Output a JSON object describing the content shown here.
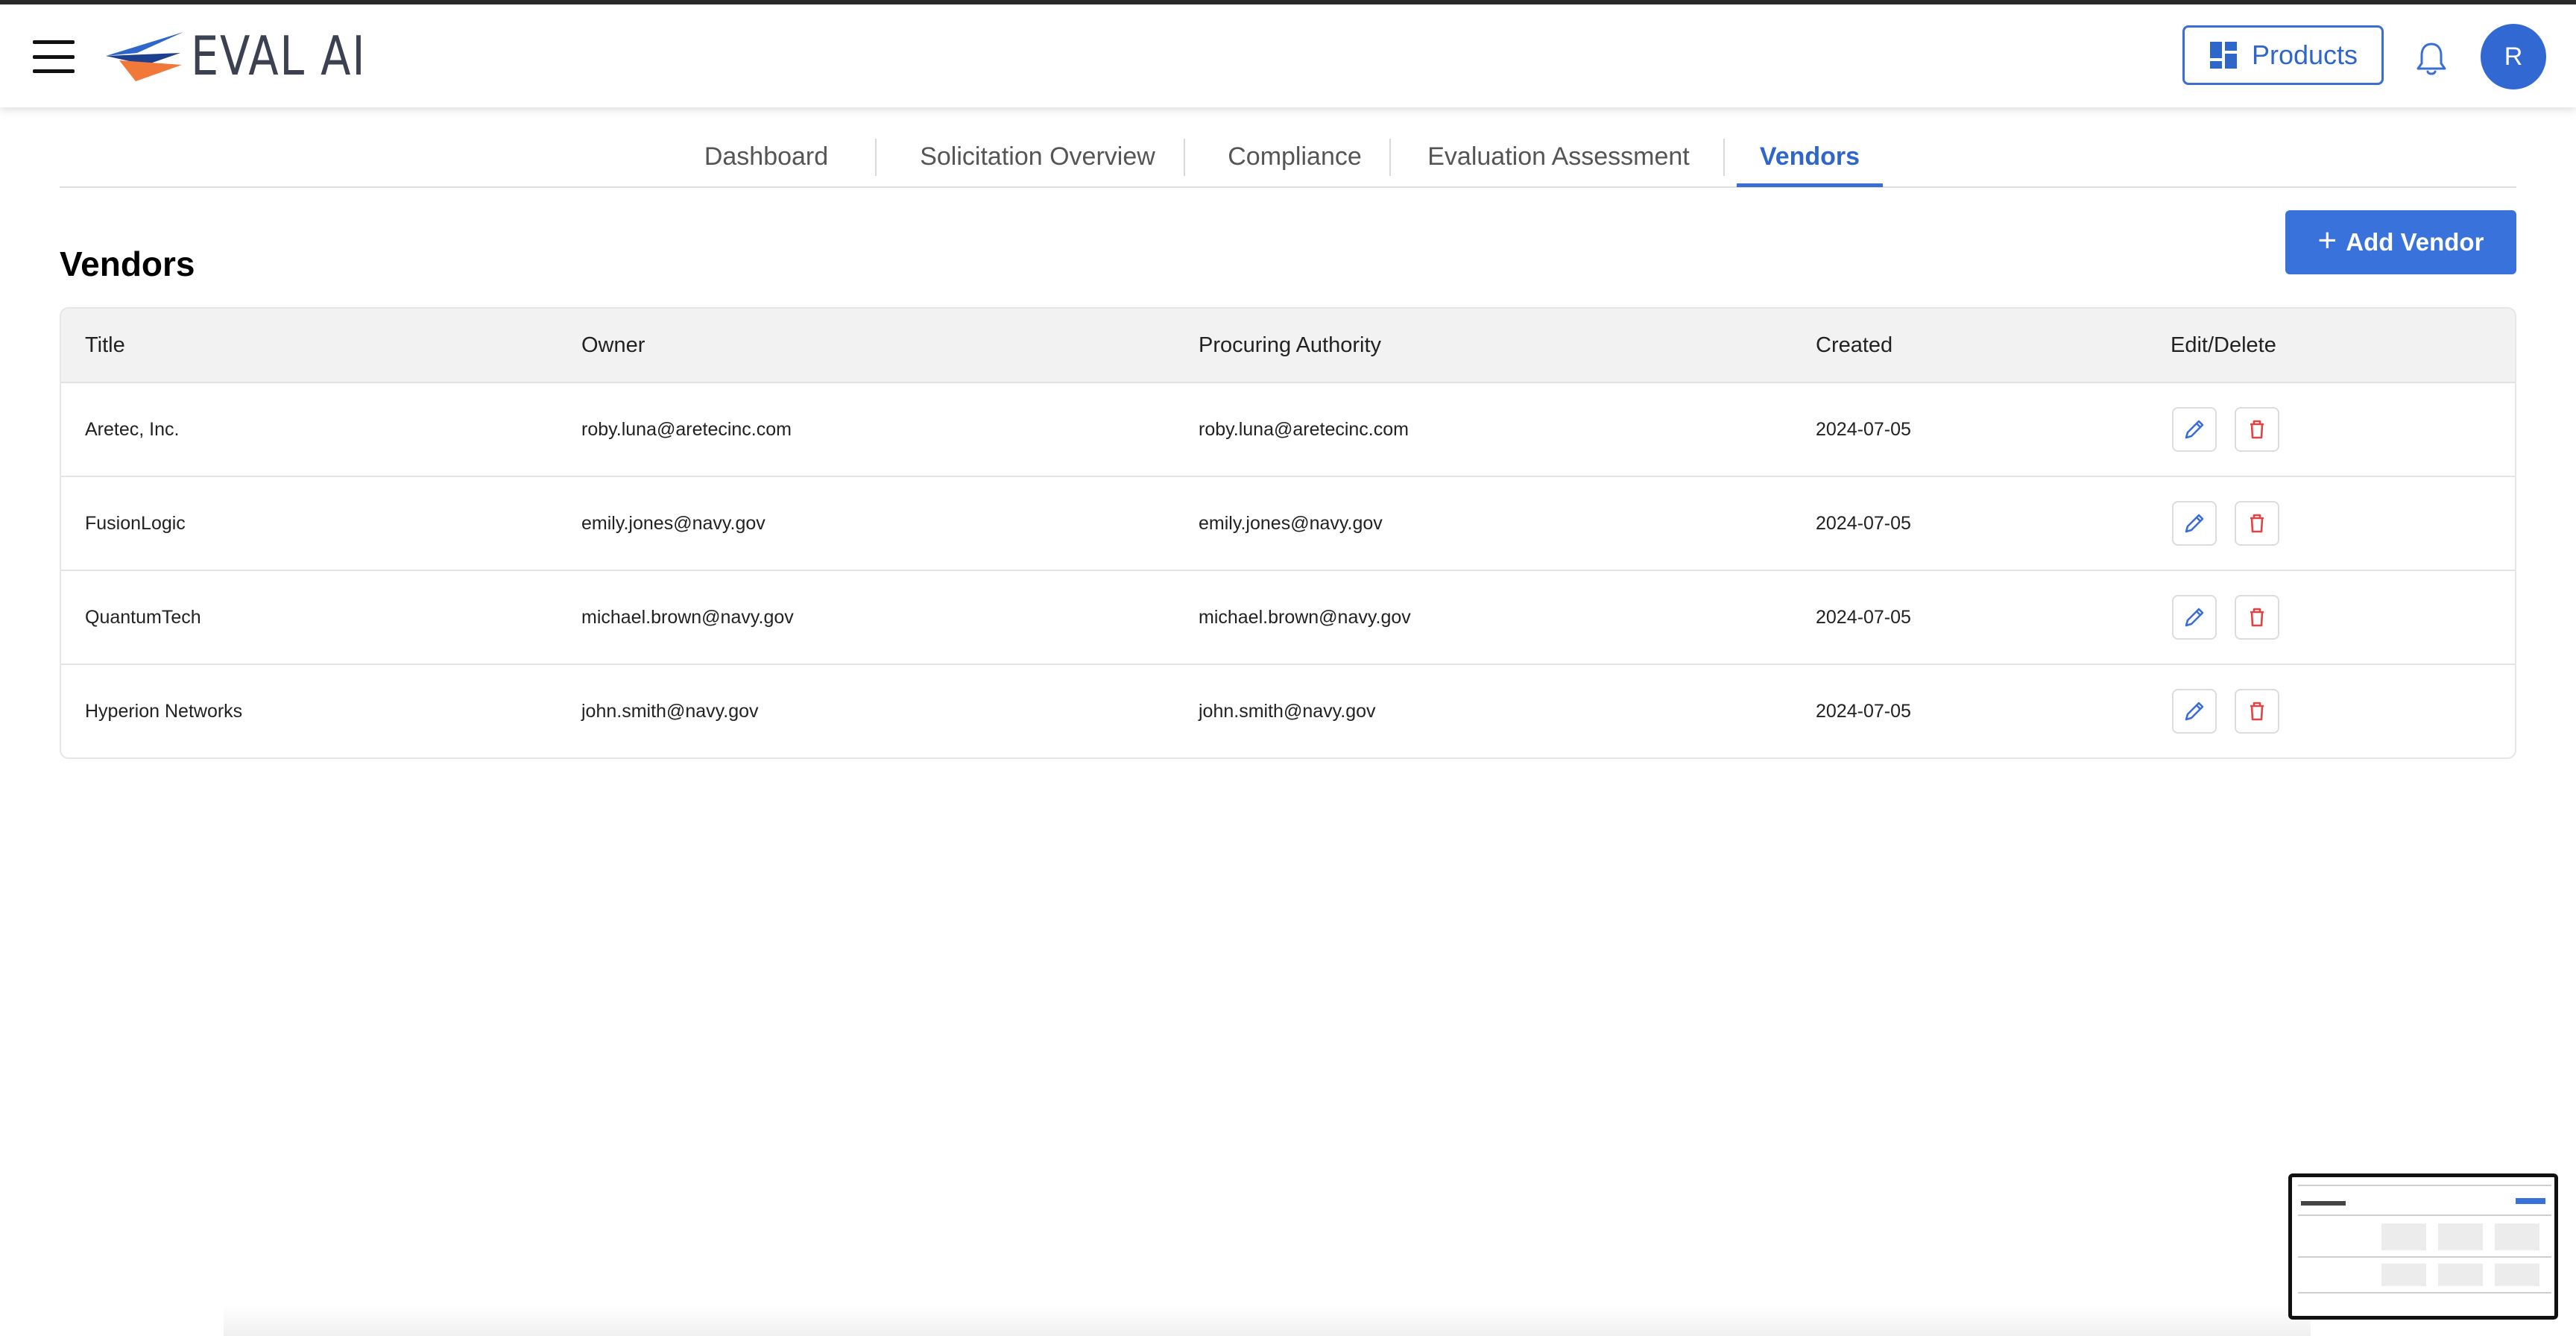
{
  "app": {
    "logo_text": "EVAL AI",
    "products_label": "Products",
    "avatar_initial": "R"
  },
  "tabs": [
    {
      "label": "Dashboard"
    },
    {
      "label": "Solicitation Overview"
    },
    {
      "label": "Compliance"
    },
    {
      "label": "Evaluation Assessment"
    },
    {
      "label": "Vendors",
      "active": true
    }
  ],
  "page": {
    "title": "Vendors",
    "add_button_label": "Add Vendor"
  },
  "table": {
    "headers": [
      "Title",
      "Owner",
      "Procuring Authority",
      "Created",
      "Edit/Delete"
    ],
    "rows": [
      [
        "Aretec, Inc.",
        "roby.luna@aretecinc.com",
        "roby.luna@aretecinc.com",
        "2024-07-05"
      ],
      [
        "FusionLogic",
        "emily.jones@navy.gov",
        "emily.jones@navy.gov",
        "2024-07-05"
      ],
      [
        "QuantumTech",
        "michael.brown@navy.gov",
        "michael.brown@navy.gov",
        "2024-07-05"
      ],
      [
        "Hyperion Networks",
        "john.smith@navy.gov",
        "john.smith@navy.gov",
        "2024-07-05"
      ]
    ]
  },
  "icons": {
    "menu": "hamburger-menu-icon",
    "products": "dashboard-grid-icon",
    "notifications": "bell-icon",
    "edit": "pencil-icon",
    "delete": "trash-icon"
  },
  "colors": {
    "primary": "#3a72db",
    "delete": "#e04545",
    "logo_orange": "#f0793a",
    "logo_blue": "#2f66c9"
  }
}
